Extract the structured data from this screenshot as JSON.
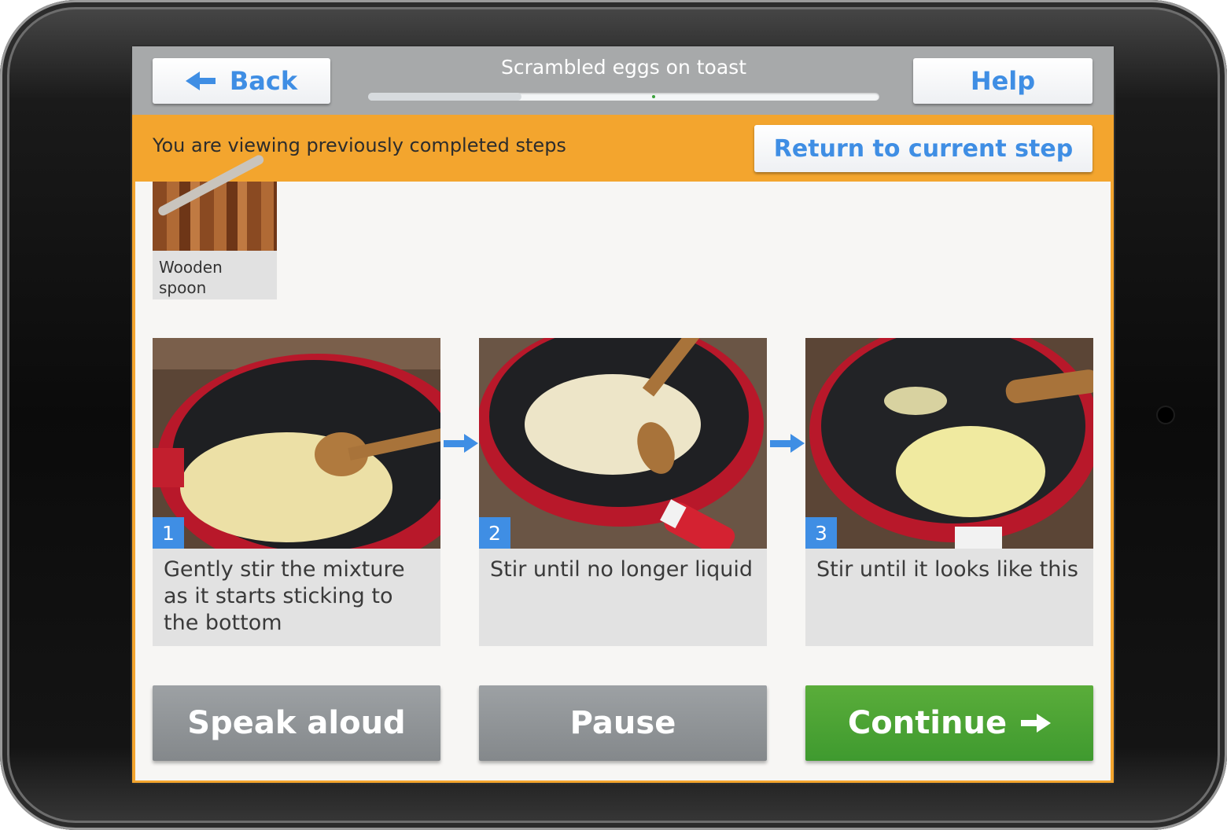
{
  "header": {
    "back_label": "Back",
    "title": "Scrambled eggs on toast",
    "help_label": "Help",
    "progress": 0.3
  },
  "banner": {
    "message": "You are viewing previously completed steps",
    "return_label": "Return to current step"
  },
  "tools": [
    {
      "label": "Wooden spoon",
      "icon": "wooden-spoon-photo"
    }
  ],
  "steps": [
    {
      "number": "1",
      "text": "Gently stir the mixture as it starts sticking to the bottom"
    },
    {
      "number": "2",
      "text": "Stir until no longer liquid"
    },
    {
      "number": "3",
      "text": "Stir until it looks like this"
    }
  ],
  "actions": {
    "speak_label": "Speak aloud",
    "pause_label": "Pause",
    "continue_label": "Continue"
  },
  "colors": {
    "banner": "#f3a52e",
    "accent_blue": "#3f8ee4",
    "continue_green": "#4aa234",
    "grey_button": "#8f9396"
  }
}
